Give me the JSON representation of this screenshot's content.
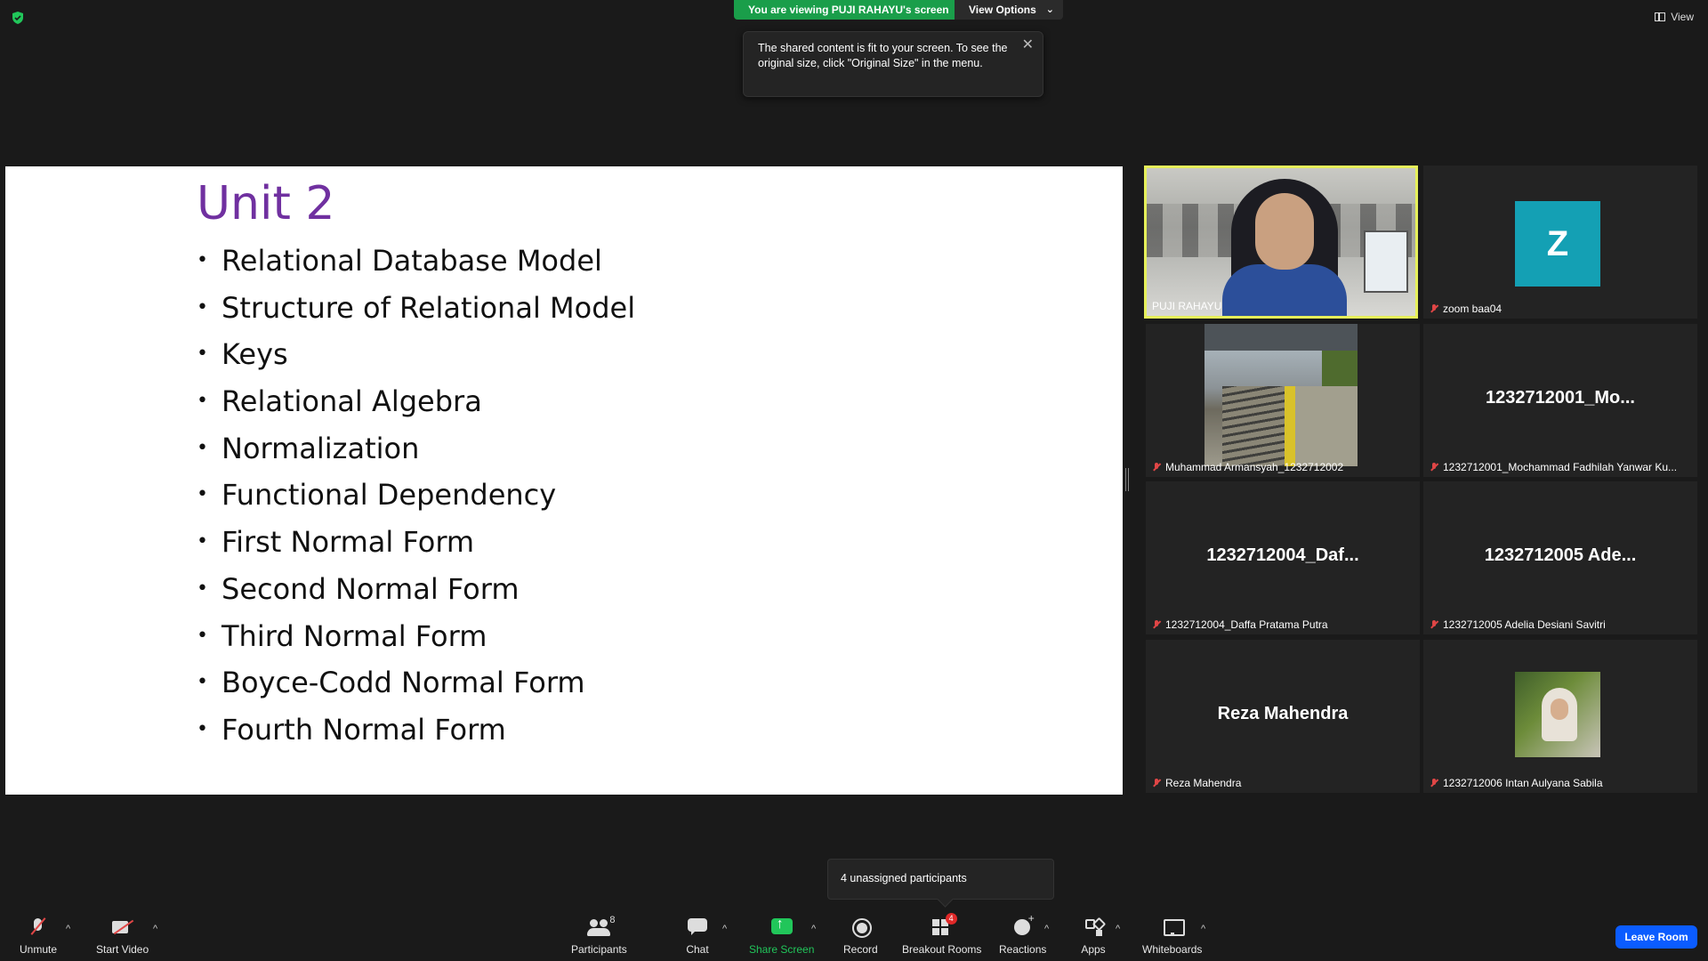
{
  "top": {
    "viewing_text": "You are viewing PUJI RAHAYU's screen",
    "view_options": "View Options",
    "view_button": "View",
    "tooltip": "The shared content is fit to your screen. To see the original size, click \"Original Size\" in the menu."
  },
  "slide": {
    "title": "Unit 2",
    "items": [
      "Relational Database Model",
      "Structure of Relational Model",
      "Keys",
      "Relational Algebra",
      "Normalization",
      "Functional Dependency",
      "First Normal Form",
      "Second Normal Form",
      "Third Normal Form",
      "Boyce-Codd Normal Form",
      "Fourth Normal Form"
    ],
    "title_color": "#7030a0"
  },
  "gallery": {
    "tiles": [
      {
        "label": "PUJI RAHAYU"
      },
      {
        "label": "zoom baa04",
        "avatar_letter": "Z"
      },
      {
        "label": "Muhammad Armansyah_1232712002"
      },
      {
        "label": "1232712001_Mochammad Fadhilah Yanwar Ku...",
        "display": "1232712001_Mo..."
      },
      {
        "label": "1232712004_Daffa Pratama Putra",
        "display": "1232712004_Daf..."
      },
      {
        "label": "1232712005 Adelia Desiani Savitri",
        "display": "1232712005 Ade..."
      },
      {
        "label": "Reza Mahendra",
        "display": "Reza Mahendra"
      },
      {
        "label": "1232712006 Intan Aulyana Sabila"
      }
    ]
  },
  "popup": {
    "unassigned": "4 unassigned participants"
  },
  "toolbar": {
    "unmute": "Unmute",
    "start_video": "Start Video",
    "participants": "Participants",
    "participants_count": "8",
    "chat": "Chat",
    "share_screen": "Share Screen",
    "record": "Record",
    "breakout_rooms": "Breakout Rooms",
    "breakout_badge": "4",
    "reactions": "Reactions",
    "apps": "Apps",
    "whiteboards": "Whiteboards",
    "leave": "Leave Room"
  },
  "colors": {
    "share_green": "#21c65a",
    "active_speaker": "#e6f05a",
    "leave_blue": "#0b5cff",
    "avatar_teal": "#14a0b4"
  }
}
